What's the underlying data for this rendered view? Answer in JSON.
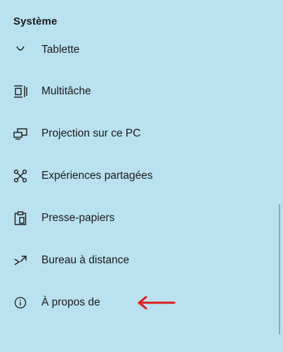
{
  "section": {
    "title": "Système"
  },
  "nav": {
    "items": [
      {
        "label": "Tablette",
        "icon": "tablet-mode-icon"
      },
      {
        "label": "Multitâche",
        "icon": "multitasking-icon"
      },
      {
        "label": "Projection sur ce PC",
        "icon": "projecting-icon"
      },
      {
        "label": "Expériences partagées",
        "icon": "shared-experiences-icon"
      },
      {
        "label": "Presse-papiers",
        "icon": "clipboard-icon"
      },
      {
        "label": "Bureau à distance",
        "icon": "remote-desktop-icon"
      },
      {
        "label": "À propos de",
        "icon": "info-icon"
      }
    ]
  },
  "annotation": {
    "arrow_color": "#e01b1b",
    "icon": "red-arrow-icon"
  },
  "colors": {
    "background": "#b9e1ef",
    "text": "#1b1b1b"
  }
}
